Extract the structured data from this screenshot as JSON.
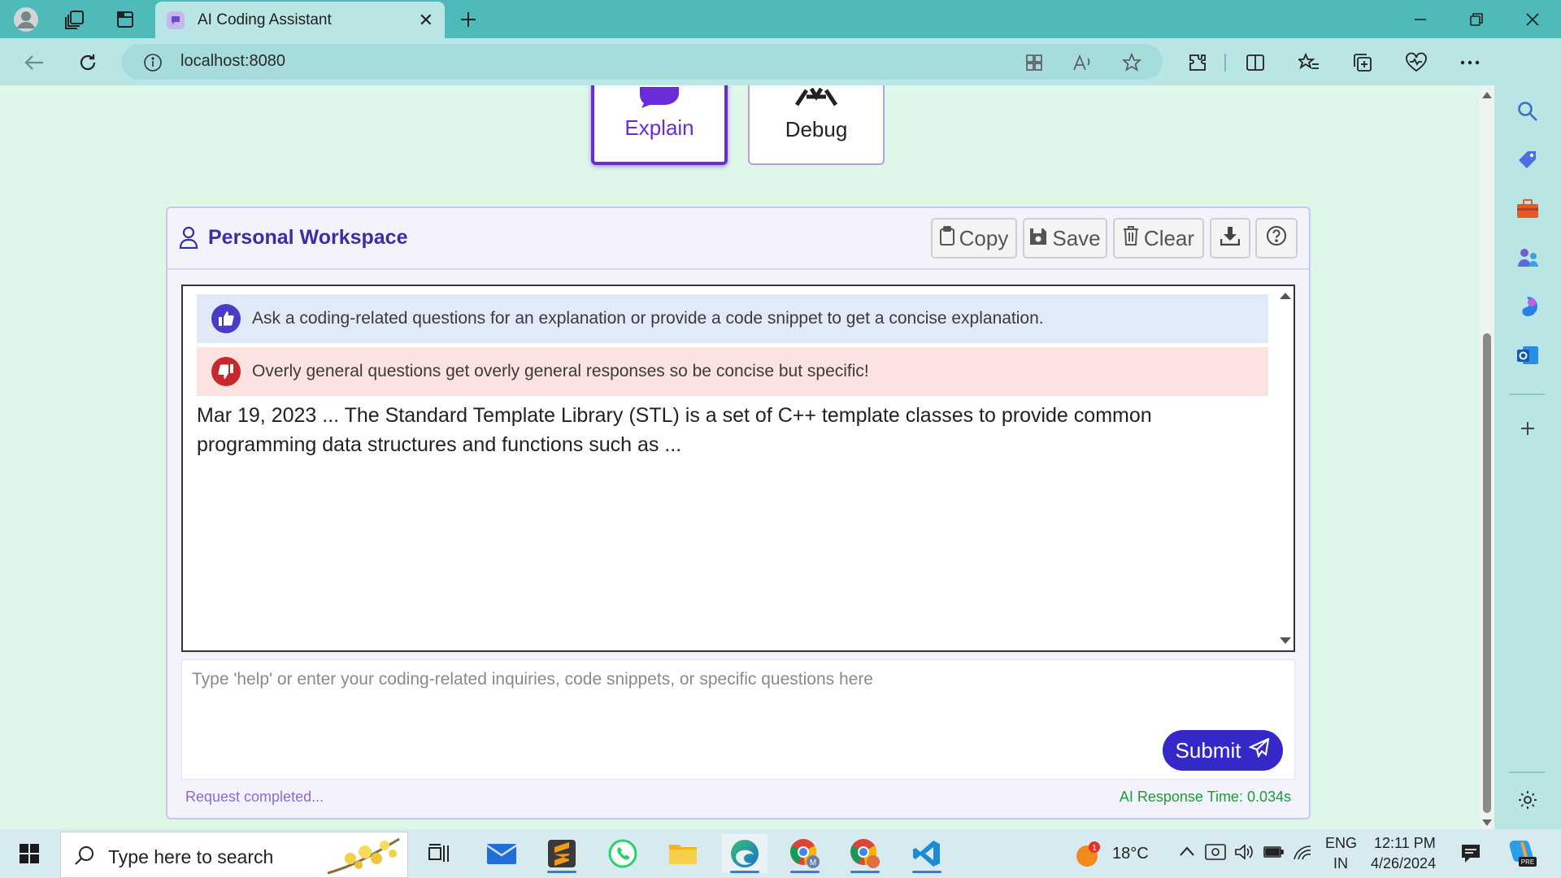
{
  "browser": {
    "tab_title": "AI Coding Assistant",
    "url": "localhost:8080"
  },
  "page": {
    "modes": [
      {
        "label": "Explain",
        "active": true
      },
      {
        "label": "Debug",
        "active": false
      }
    ],
    "workspace": {
      "title": "Personal Workspace",
      "actions": {
        "copy": "Copy",
        "save": "Save",
        "clear": "Clear"
      },
      "info_alert": "Ask a coding-related questions for an explanation or provide a code snippet to get a concise explanation.",
      "warn_alert": "Overly general questions get overly general responses so be concise but specific!",
      "response": "Mar 19, 2023 ... The Standard Template Library (STL) is a set of C++ template classes to provide common programming data structures and functions such as ...",
      "input_placeholder": "Type 'help' or enter your coding-related inquiries, code snippets, or specific questions here",
      "submit_label": "Submit",
      "status": "Request completed...",
      "response_time": "AI Response Time: 0.034s"
    }
  },
  "taskbar": {
    "search_placeholder": "Type here to search",
    "weather": "18°C",
    "weather_badge": "1",
    "language": "ENG",
    "region": "IN",
    "time": "12:11 PM",
    "date": "4/26/2024"
  },
  "colors": {
    "accent": "#3528c8",
    "explain_purple": "#6a2bd8",
    "page_bg": "#dff7e8",
    "browser_chrome": "#4fbaba",
    "success_green": "#1f9a3d"
  }
}
